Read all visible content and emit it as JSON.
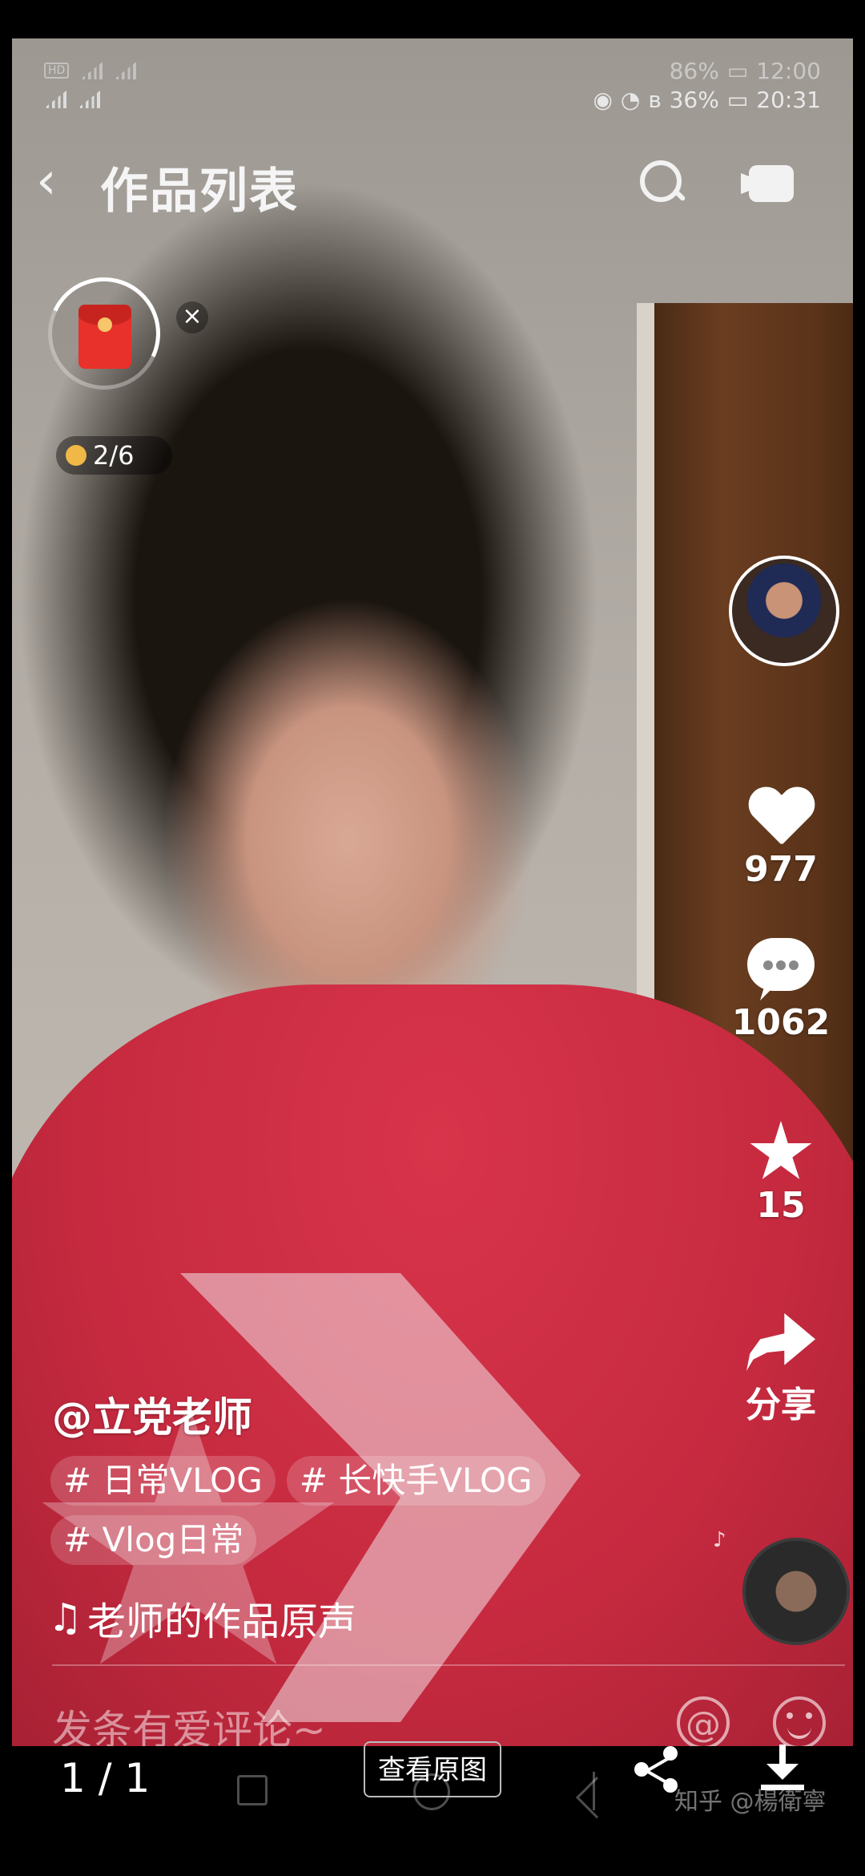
{
  "status_bar": {
    "back": {
      "battery": "86%",
      "time": "12:00"
    },
    "front": {
      "battery": "36%",
      "time": "20:31"
    }
  },
  "header": {
    "title": "作品列表"
  },
  "widget": {
    "progress": "2/6"
  },
  "actions": {
    "likes": "977",
    "comments": "1062",
    "favorites": "15",
    "share_label": "分享"
  },
  "video": {
    "author": "@立党老师",
    "tags": [
      "# 日常VLOG",
      "# 长快手VLOG",
      "# Vlog日常"
    ],
    "music": "老师的作品原声"
  },
  "comment_bar": {
    "placeholder": "发条有爱评论~"
  },
  "viewer": {
    "page_counter": "1 / 1",
    "view_original": "查看原图",
    "watermark": "知乎 @楊衛寧"
  }
}
